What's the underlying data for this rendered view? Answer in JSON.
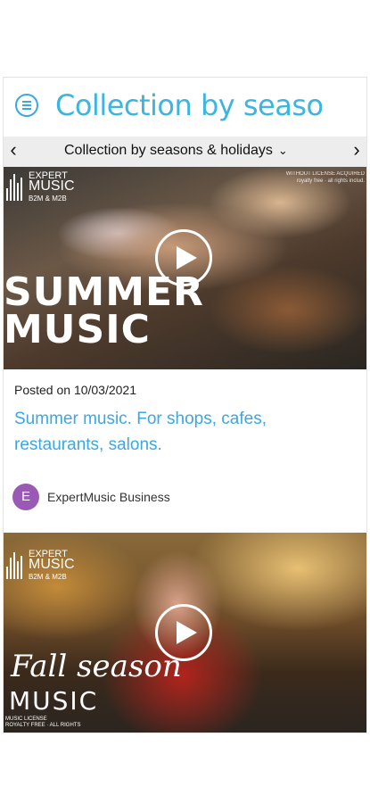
{
  "header": {
    "title": "Collection by seaso",
    "menu_icon": "menu-circle-icon"
  },
  "nav": {
    "dropdown_label": "Collection by seasons & holidays",
    "chevron": "⌄",
    "prev": "‹",
    "next": "›"
  },
  "posts": [
    {
      "logo_top": "EXPERT",
      "logo_mid": "MUSIC",
      "logo_bottom": "B2M & M2B",
      "overlay_title_1": "SUMMER",
      "overlay_title_2": "MUSIC",
      "rights_1": "WITHOUT LICENSE ACQUIRED",
      "rights_2": "royalty free · all rights includ.",
      "date": "Posted on 10/03/2021",
      "title": "Summer music. For shops, cafes, restaurants, salons.",
      "author_initial": "E",
      "author": "ExpertMusic Business",
      "avatar_color": "#9b59b6"
    },
    {
      "logo_top": "EXPERT",
      "logo_mid": "MUSIC",
      "logo_bottom": "B2M & M2B",
      "overlay_script": "Fall season",
      "overlay_title": "MUSIC",
      "license_1": "MUSIC LICENSE",
      "license_2": "ROYALTY FREE · ALL RIGHTS"
    }
  ],
  "colors": {
    "accent": "#3ca7e0",
    "nav_bg": "#ededed"
  }
}
